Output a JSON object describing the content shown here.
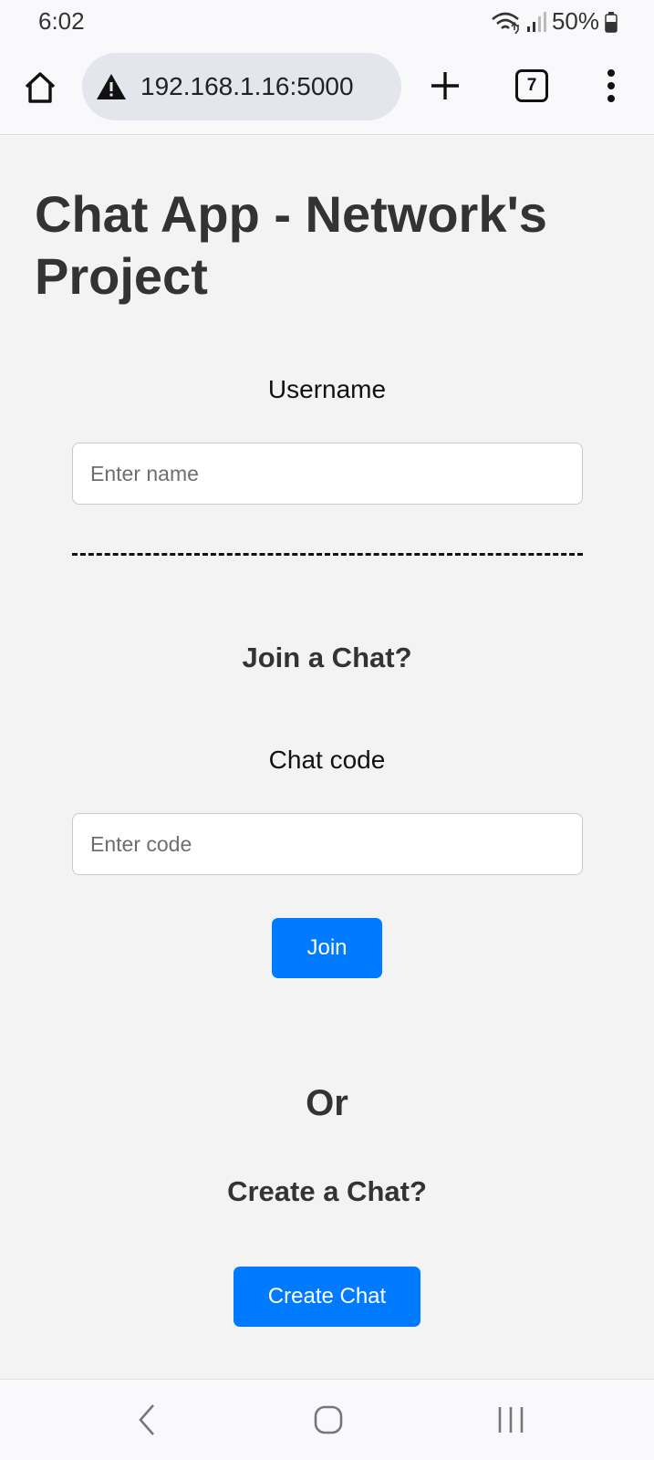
{
  "status_bar": {
    "time": "6:02",
    "battery": "50%",
    "icons": [
      "wifi-icon",
      "signal-icon",
      "battery-icon"
    ]
  },
  "browser": {
    "url": "192.168.1.16:5000",
    "tab_count": "7",
    "icons": [
      "home-icon",
      "warning-icon",
      "plus-icon",
      "menu-icon"
    ]
  },
  "page": {
    "title": "Chat App - Network's Project",
    "username_label": "Username",
    "username_placeholder": "Enter name",
    "join_heading": "Join a Chat?",
    "chat_code_label": "Chat code",
    "chat_code_placeholder": "Enter code",
    "join_button": "Join",
    "or_text": "Or",
    "create_heading": "Create a Chat?",
    "create_button": "Create Chat"
  },
  "nav_bar": {
    "icons": [
      "back-icon",
      "home-icon",
      "recents-icon"
    ]
  },
  "colors": {
    "accent": "#007bff",
    "page_background": "#f3f3f3",
    "text": "#333333"
  }
}
